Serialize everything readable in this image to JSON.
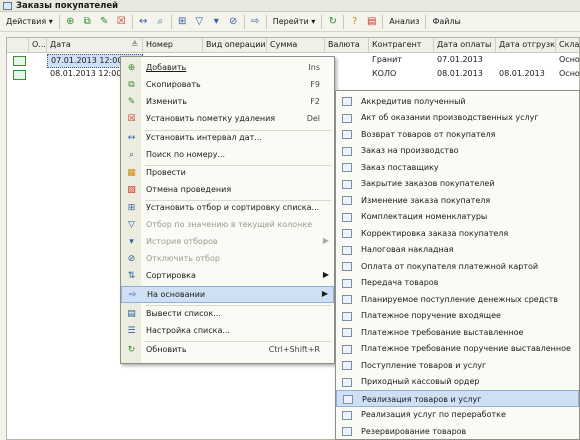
{
  "window": {
    "title": "Заказы покупателей"
  },
  "toolbar": {
    "actions_label": "Действия",
    "goto_label": "Перейти",
    "analysis_label": "Анализ",
    "files_label": "Файлы"
  },
  "grid": {
    "columns": [
      "О...",
      "Дата",
      "Номер",
      "Вид операции",
      "Сумма",
      "Валюта",
      "Контрагент",
      "Дата оплаты",
      "Дата отгрузки",
      "Склад"
    ],
    "rows": [
      {
        "date": "07.01.2013 12:00:00",
        "number": "",
        "op": "",
        "sum": "",
        "cur": "",
        "contractor": "Гранит",
        "pay_date": "07.01.2013",
        "ship_date": "",
        "warehouse": "Основ"
      },
      {
        "date": "08.01.2013 12:00:00",
        "number": "",
        "op": "",
        "sum": "",
        "cur": "",
        "contractor": "КОЛО",
        "pay_date": "08.01.2013",
        "ship_date": "08.01.2013",
        "warehouse": "Основ"
      }
    ]
  },
  "context_menu": [
    {
      "label": "Добавить",
      "shortcut": "Ins",
      "icon": "add-icon"
    },
    {
      "label": "Скопировать",
      "shortcut": "F9",
      "icon": "copy-icon"
    },
    {
      "label": "Изменить",
      "shortcut": "F2",
      "icon": "edit-icon"
    },
    {
      "label": "Установить пометку удаления",
      "shortcut": "Del",
      "icon": "delete-mark-icon"
    },
    {
      "label": "Установить интервал дат...",
      "shortcut": "",
      "icon": "date-interval-icon"
    },
    {
      "label": "Поиск по номеру...",
      "shortcut": "",
      "icon": "search-icon"
    },
    {
      "label": "Провести",
      "shortcut": "",
      "icon": "post-icon"
    },
    {
      "label": "Отмена проведения",
      "shortcut": "",
      "icon": "unpost-icon"
    },
    {
      "label": "Установить отбор и сортировку списка...",
      "shortcut": "",
      "icon": "filter-sort-icon"
    },
    {
      "label": "Отбор по значению в текущей колонке",
      "shortcut": "",
      "icon": "filter-value-icon"
    },
    {
      "label": "История отборов",
      "shortcut": "",
      "icon": "filter-history-icon"
    },
    {
      "label": "Отключить отбор",
      "shortcut": "",
      "icon": "filter-off-icon"
    },
    {
      "label": "Сортировка",
      "shortcut": "",
      "icon": "sort-icon"
    },
    {
      "label": "На основании",
      "shortcut": "",
      "icon": "based-on-icon"
    },
    {
      "label": "Вывести список...",
      "shortcut": "",
      "icon": "print-list-icon"
    },
    {
      "label": "Настройка списка...",
      "shortcut": "",
      "icon": "list-settings-icon"
    },
    {
      "label": "Обновить",
      "shortcut": "Ctrl+Shift+R",
      "icon": "refresh-icon"
    }
  ],
  "submenu": [
    "Аккредитив полученный",
    "Акт об оказании производственных услуг",
    "Возврат товаров от покупателя",
    "Заказ на производство",
    "Заказ поставщику",
    "Закрытие заказов покупателей",
    "Изменение заказа покупателя",
    "Комплектация номенклатуры",
    "Корректировка заказа покупателя",
    "Налоговая накладная",
    "Оплата от покупателя платежной картой",
    "Передача товаров",
    "Планируемое поступление денежных средств",
    "Платежное поручение входящее",
    "Платежное требование выставленное",
    "Платежное требование поручение выставленное",
    "Поступление товаров и услуг",
    "Приходный кассовый ордер",
    "Реализация товаров и услуг",
    "Реализация услуг по переработке",
    "Резервирование товаров"
  ]
}
